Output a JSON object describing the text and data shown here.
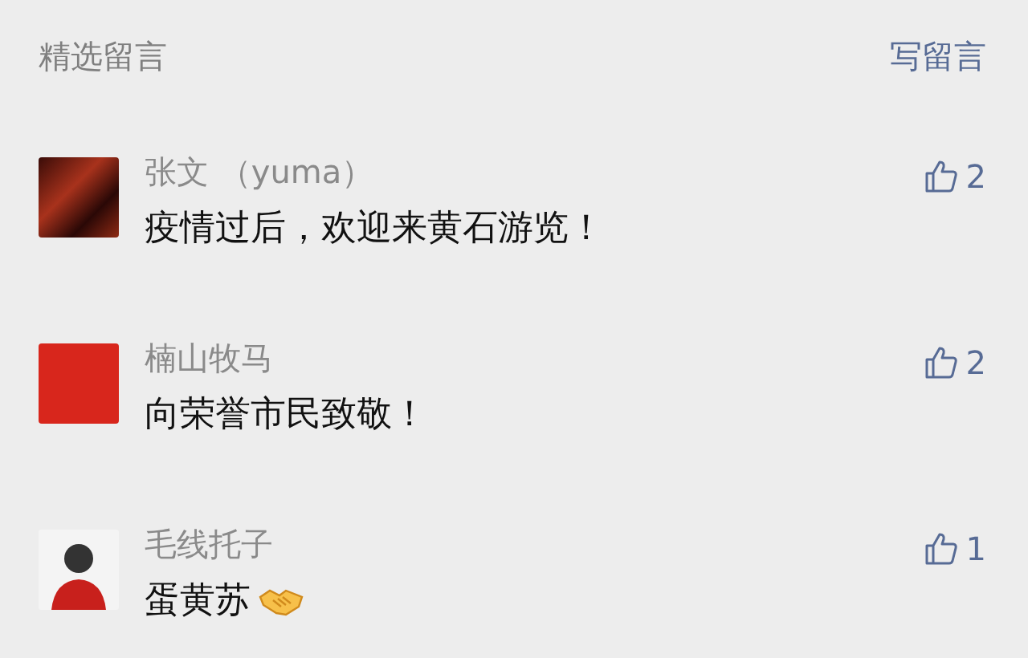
{
  "header": {
    "title": "精选留言",
    "write_link": "写留言"
  },
  "comments": [
    {
      "avatar": {
        "kind": "photo"
      },
      "name": "张文 （yuma）",
      "text": "疫情过后，欢迎来黄石游览！",
      "likes": "2"
    },
    {
      "avatar": {
        "kind": "logo"
      },
      "name": "楠山牧马",
      "text": "向荣誉市民致敬！",
      "likes": "2"
    },
    {
      "avatar": {
        "kind": "person"
      },
      "name": "毛线托子",
      "text": "蛋黄苏",
      "icons": [
        {
          "kind": "handshake"
        }
      ],
      "likes": "1"
    }
  ]
}
